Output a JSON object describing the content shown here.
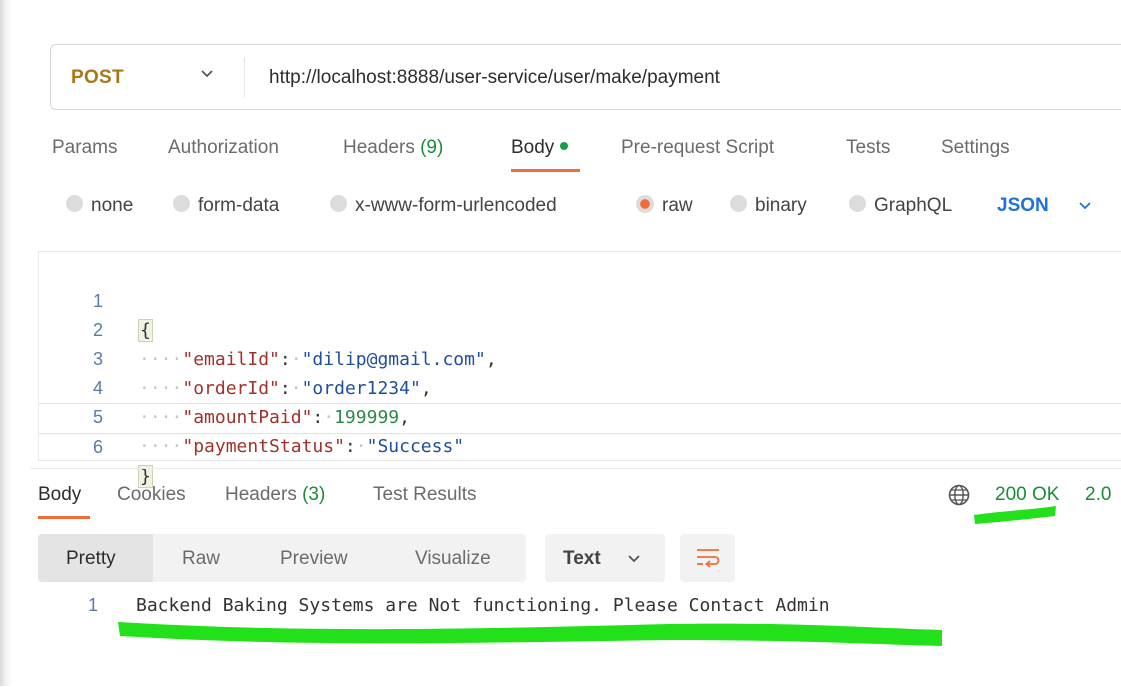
{
  "request": {
    "method": "POST",
    "url": "http://localhost:8888/user-service/user/make/payment"
  },
  "request_tabs": [
    {
      "label": "Params"
    },
    {
      "label": "Authorization"
    },
    {
      "label": "Headers",
      "count": "(9)"
    },
    {
      "label": "Body",
      "active": true
    },
    {
      "label": "Pre-request Script"
    },
    {
      "label": "Tests"
    },
    {
      "label": "Settings"
    }
  ],
  "body_types": [
    {
      "label": "none"
    },
    {
      "label": "form-data"
    },
    {
      "label": "x-www-form-urlencoded"
    },
    {
      "label": "raw",
      "selected": true
    },
    {
      "label": "binary"
    },
    {
      "label": "GraphQL"
    }
  ],
  "body_language": "JSON",
  "editor": {
    "line_numbers": [
      "1",
      "2",
      "3",
      "4",
      "5",
      "6"
    ],
    "open_brace": "{",
    "close_brace": "}",
    "fields": [
      {
        "key": "\"emailId\"",
        "value": "\"dilip@gmail.com\"",
        "comma": ","
      },
      {
        "key": "\"orderId\"",
        "value": "\"order1234\"",
        "comma": ","
      },
      {
        "key": "\"amountPaid\"",
        "value": "199999",
        "comma": ","
      },
      {
        "key": "\"paymentStatus\"",
        "value": "\"Success\"",
        "comma": ""
      }
    ]
  },
  "response_tabs": [
    {
      "label": "Body",
      "active": true
    },
    {
      "label": "Cookies"
    },
    {
      "label": "Headers",
      "count": "(3)"
    },
    {
      "label": "Test Results"
    }
  ],
  "response_status": "200 OK",
  "response_time": "2.0",
  "format_buttons": [
    {
      "label": "Pretty",
      "active": true
    },
    {
      "label": "Raw"
    },
    {
      "label": "Preview"
    },
    {
      "label": "Visualize"
    }
  ],
  "response_format": "Text",
  "response_body": {
    "line_number": "1",
    "text": "Backend Baking Systems are Not functioning. Please Contact Admin"
  },
  "colors": {
    "accent": "#f26b3a",
    "method": "#a6781a",
    "status_ok": "#1d8a3a",
    "json_blue": "#1e73d8",
    "highlighter": "#22e01a"
  }
}
